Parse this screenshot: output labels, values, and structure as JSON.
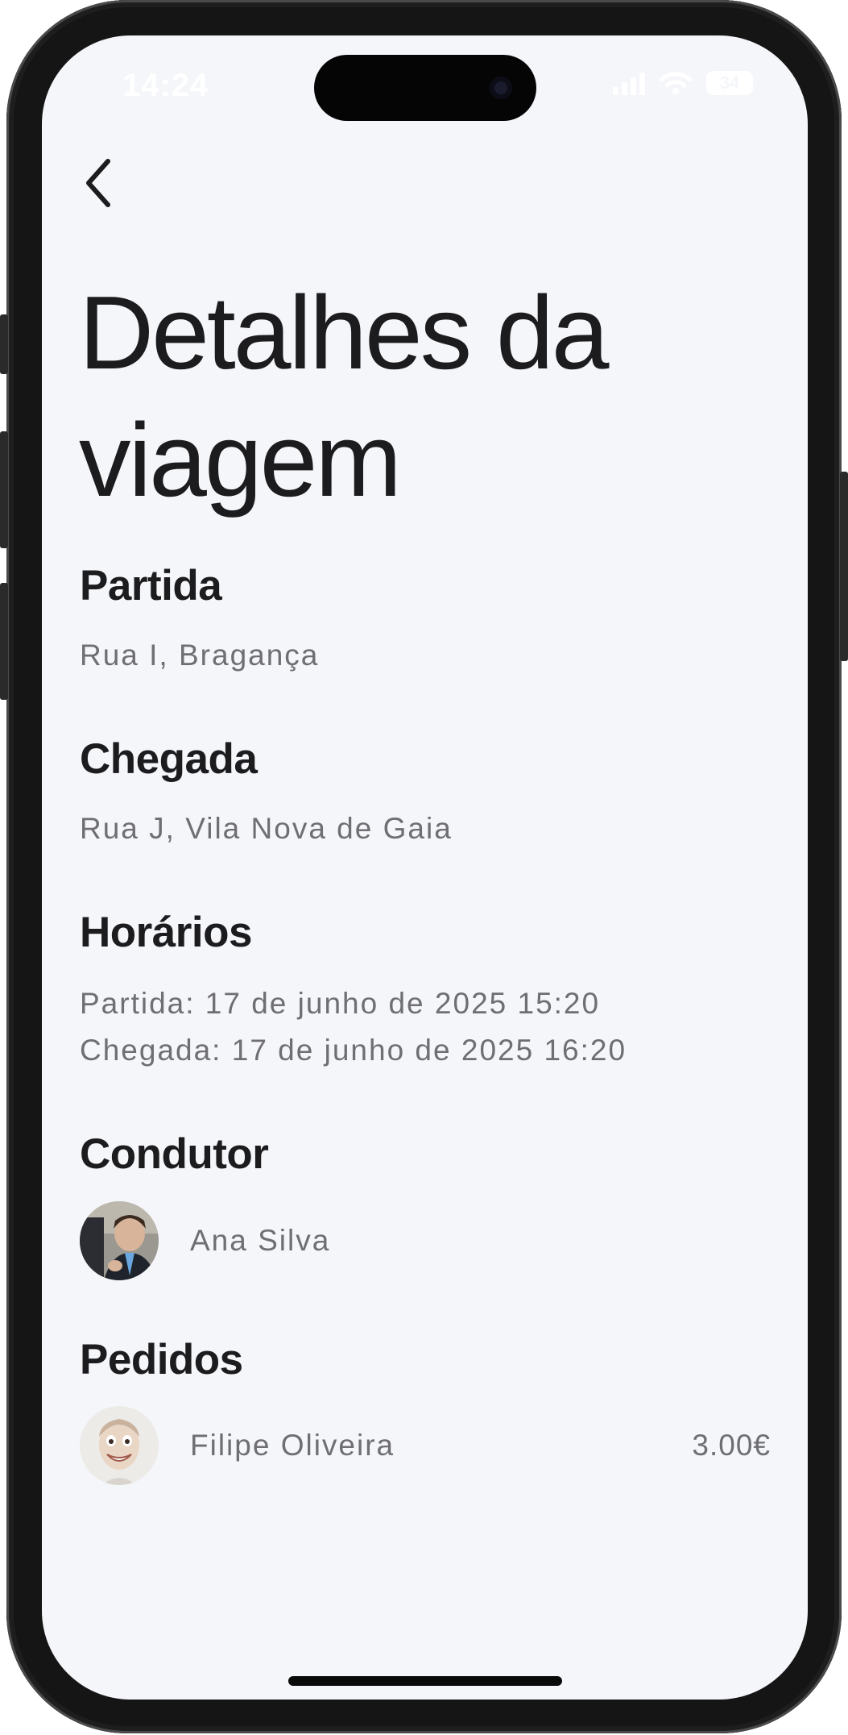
{
  "status_bar": {
    "time": "14:24",
    "battery": "34"
  },
  "page": {
    "title_line1": "Detalhes da",
    "title_line2": "viagem"
  },
  "departure": {
    "heading": "Partida",
    "address": "Rua I, Bragança"
  },
  "arrival": {
    "heading": "Chegada",
    "address": "Rua J, Vila Nova de Gaia"
  },
  "schedule": {
    "heading": "Horários",
    "departure_line": "Partida: 17 de junho de 2025 15:20",
    "arrival_line": "Chegada: 17 de junho de 2025 16:20"
  },
  "driver": {
    "heading": "Condutor",
    "name": "Ana Silva"
  },
  "requests": {
    "heading": "Pedidos",
    "items": [
      {
        "name": "Filipe Oliveira",
        "price": "3.00€"
      }
    ]
  },
  "colors": {
    "background": "#f5f6fa",
    "heading": "#1c1c1e",
    "secondary_text": "#6e6e73"
  }
}
